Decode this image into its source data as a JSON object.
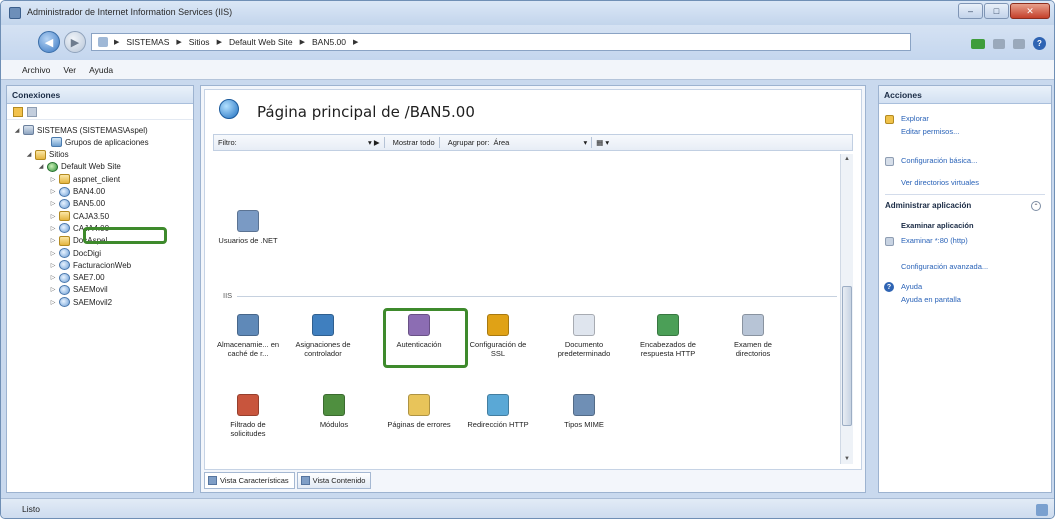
{
  "window": {
    "title": "Administrador de Internet Information Services (IIS)"
  },
  "address": {
    "crumbs": [
      "SISTEMAS",
      "Sitios",
      "Default Web Site",
      "BAN5.00"
    ]
  },
  "menu": {
    "items": [
      "Archivo",
      "Ver",
      "Ayuda"
    ]
  },
  "connections": {
    "header": "Conexiones",
    "tree": [
      {
        "label": "SISTEMAS (SISTEMAS\\Aspel)",
        "icon": "server-icon",
        "toggle": "◢"
      },
      {
        "label": "Grupos de aplicaciones",
        "icon": "app-pool-icon",
        "toggle": ""
      },
      {
        "label": "Sitios",
        "icon": "sites-folder-icon",
        "toggle": "◢"
      },
      {
        "label": "Default Web Site",
        "icon": "globe-icon",
        "toggle": "◢"
      },
      {
        "label": "aspnet_client",
        "icon": "folder-icon",
        "toggle": "▷"
      },
      {
        "label": "BAN4.00",
        "icon": "application-icon",
        "toggle": "▷"
      },
      {
        "label": "BAN5.00",
        "icon": "application-icon",
        "toggle": "▷"
      },
      {
        "label": "CAJA3.50",
        "icon": "folder-icon",
        "toggle": "▷"
      },
      {
        "label": "CAJA4.00",
        "icon": "application-icon",
        "toggle": "▷"
      },
      {
        "label": "DocAspel",
        "icon": "folder-icon",
        "toggle": "▷"
      },
      {
        "label": "DocDigi",
        "icon": "application-icon",
        "toggle": "▷"
      },
      {
        "label": "FacturacionWeb",
        "icon": "application-icon",
        "toggle": "▷"
      },
      {
        "label": "SAE7.00",
        "icon": "application-icon",
        "toggle": "▷"
      },
      {
        "label": "SAEMovil",
        "icon": "application-icon",
        "toggle": "▷"
      },
      {
        "label": "SAEMovil2",
        "icon": "application-icon",
        "toggle": "▷"
      }
    ]
  },
  "main": {
    "title": "Página principal de /BAN5.00",
    "filter": {
      "label": "Filtro:",
      "show_all": "Mostrar todo",
      "group_by": "Agrupar por:",
      "group_value": "Área"
    },
    "group_iis": "IIS",
    "aspnet_features": [
      {
        "label": "Usuarios de .NET",
        "icon": "users-icon",
        "color": "#7a9ac4"
      }
    ],
    "iis_features_row1": [
      {
        "label": "Almacenamie... en caché de r...",
        "icon": "output-cache-icon",
        "color": "#5f89b8"
      },
      {
        "label": "Asignaciones de controlador",
        "icon": "handler-mappings-icon",
        "color": "#3f7fbf"
      },
      {
        "label": "Autenticación",
        "icon": "authentication-icon",
        "color": "#8c6db3"
      },
      {
        "label": "Configuración de SSL",
        "icon": "ssl-lock-icon",
        "color": "#e0a216"
      },
      {
        "label": "Documento predeterminado",
        "icon": "default-document-icon",
        "color": "#dfe5ee"
      },
      {
        "label": "Encabezados de respuesta HTTP",
        "icon": "http-headers-icon",
        "color": "#4b9f57"
      },
      {
        "label": "Examen de directorios",
        "icon": "directory-browsing-icon",
        "color": "#b7c4d6"
      }
    ],
    "iis_features_row2": [
      {
        "label": "Filtrado de solicitudes",
        "icon": "request-filtering-icon",
        "color": "#c8553d"
      },
      {
        "label": "Módulos",
        "icon": "modules-icon",
        "color": "#4f8f3f"
      },
      {
        "label": "Páginas de errores",
        "icon": "error-pages-icon",
        "color": "#e8c45a"
      },
      {
        "label": "Redirección HTTP",
        "icon": "http-redirect-icon",
        "color": "#5aa8d6"
      },
      {
        "label": "Tipos MIME",
        "icon": "mime-types-icon",
        "color": "#6f8fb5"
      }
    ],
    "tabs": [
      "Vista Características",
      "Vista Contenido"
    ]
  },
  "actions": {
    "header": "Acciones",
    "explore": "Explorar",
    "edit_permissions": "Editar permisos...",
    "basic_settings": "Configuración básica...",
    "view_virtual_dirs": "Ver directorios virtuales",
    "manage_app": "Administrar aplicación",
    "browse_app": "Examinar aplicación",
    "browse_80": "Examinar *:80 (http)",
    "advanced_settings": "Configuración avanzada...",
    "help": "Ayuda",
    "online_help": "Ayuda en pantalla"
  },
  "status": {
    "text": "Listo"
  },
  "colors": {
    "highlight": "#3e8a2c",
    "link": "#2a63b8"
  }
}
